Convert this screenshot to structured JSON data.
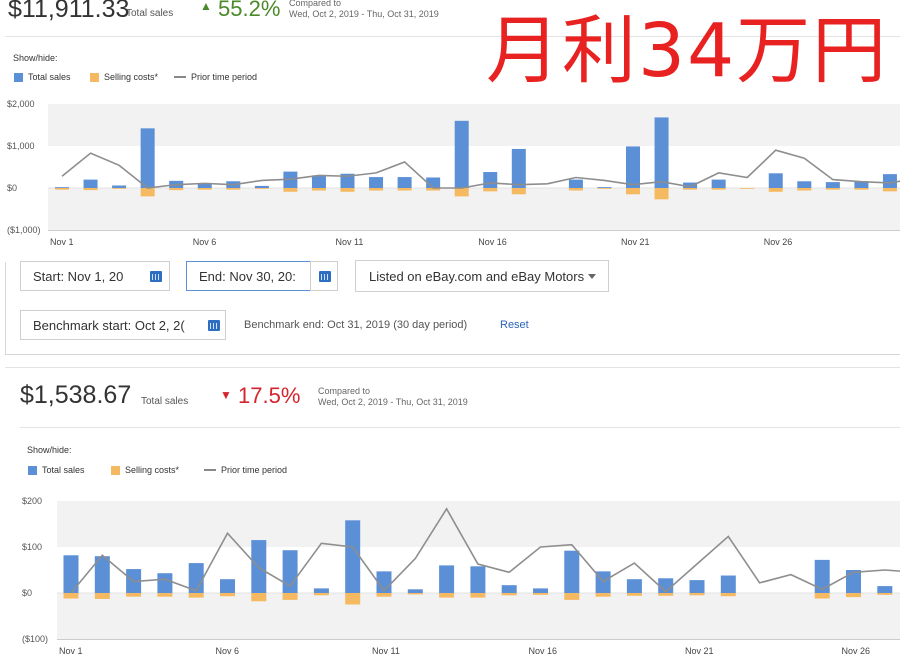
{
  "overlay": {
    "text": "月利34万円"
  },
  "colors": {
    "total_sales": "#5b8fd6",
    "selling_costs": "#f5b961",
    "prior": "#8e8e8e",
    "up": "#4a8a2a",
    "down": "#d4242d",
    "link": "#2a64b8",
    "overlay": "#e82121"
  },
  "panel1": {
    "total": "$11,911.33",
    "total_label": "Total sales",
    "change_arrow": "▲",
    "change": "55.2%",
    "compared_label": "Compared to",
    "compared_range": "Wed, Oct 2, 2019 - Thu, Oct 31, 2019",
    "showhide_label": "Show/hide:",
    "legend": {
      "total_sales": "Total sales",
      "selling_costs": "Selling costs*",
      "prior": "Prior time period"
    }
  },
  "controls": {
    "start_value": "Start: Nov 1, 20",
    "end_value": "End: Nov 30, 20:",
    "listing_select": "Listed on eBay.com and eBay Motors",
    "benchmark_start_value": "Benchmark start: Oct 2, 2(",
    "benchmark_end_text": "Benchmark end: Oct 31, 2019 (30 day period)",
    "reset_label": "Reset"
  },
  "panel2": {
    "total": "$1,538.67",
    "total_label": "Total sales",
    "change_arrow": "▼",
    "change": "17.5%",
    "compared_label": "Compared to",
    "compared_range": "Wed, Oct 2, 2019 - Thu, Oct 31, 2019",
    "showhide_label": "Show/hide:",
    "legend": {
      "total_sales": "Total sales",
      "selling_costs": "Selling costs*",
      "prior": "Prior time period"
    }
  },
  "chart_data": [
    {
      "type": "bar",
      "ylim": [
        -1000,
        2000
      ],
      "y_ticks": [
        -1000,
        0,
        1000,
        2000
      ],
      "y_tick_labels": [
        "($1,000)",
        "$0",
        "$1,000",
        "$2,000"
      ],
      "categories": [
        "Nov 1",
        "Nov 2",
        "Nov 3",
        "Nov 4",
        "Nov 5",
        "Nov 6",
        "Nov 7",
        "Nov 8",
        "Nov 9",
        "Nov 10",
        "Nov 11",
        "Nov 12",
        "Nov 13",
        "Nov 14",
        "Nov 15",
        "Nov 16",
        "Nov 17",
        "Nov 18",
        "Nov 19",
        "Nov 20",
        "Nov 21",
        "Nov 22",
        "Nov 23",
        "Nov 24",
        "Nov 25",
        "Nov 26",
        "Nov 27",
        "Nov 28",
        "Nov 29",
        "Nov 30"
      ],
      "x_tick_labels": [
        "Nov 1",
        "Nov 6",
        "Nov 11",
        "Nov 16",
        "Nov 21",
        "Nov 26"
      ],
      "x_tick_indices": [
        0,
        5,
        10,
        15,
        20,
        25
      ],
      "series": [
        {
          "name": "Total sales",
          "values": [
            20,
            200,
            60,
            1420,
            170,
            110,
            160,
            50,
            390,
            300,
            340,
            260,
            260,
            250,
            1600,
            380,
            930,
            0,
            200,
            20,
            990,
            1680,
            130,
            200,
            0,
            350,
            160,
            140,
            160,
            330,
            210
          ]
        },
        {
          "name": "Selling costs*",
          "values": [
            -40,
            -50,
            -20,
            -200,
            -50,
            -40,
            -40,
            -20,
            -90,
            -60,
            -90,
            -60,
            -60,
            -60,
            -200,
            -80,
            -150,
            0,
            -60,
            -20,
            -150,
            -270,
            -40,
            -40,
            -20,
            -90,
            -60,
            -40,
            -40,
            -80,
            -60
          ]
        },
        {
          "name": "Prior time period",
          "values": [
            280,
            830,
            540,
            0,
            80,
            110,
            80,
            180,
            210,
            300,
            280,
            360,
            620,
            0,
            0,
            120,
            80,
            100,
            250,
            180,
            80,
            150,
            30,
            360,
            250,
            900,
            710,
            200,
            150,
            120,
            240,
            250
          ]
        }
      ]
    },
    {
      "type": "bar",
      "ylim": [
        -100,
        200
      ],
      "y_ticks": [
        -100,
        0,
        100,
        200
      ],
      "y_tick_labels": [
        "($100)",
        "$0",
        "$100",
        "$200"
      ],
      "categories": [
        "Nov 1",
        "Nov 2",
        "Nov 3",
        "Nov 4",
        "Nov 5",
        "Nov 6",
        "Nov 7",
        "Nov 8",
        "Nov 9",
        "Nov 10",
        "Nov 11",
        "Nov 12",
        "Nov 13",
        "Nov 14",
        "Nov 15",
        "Nov 16",
        "Nov 17",
        "Nov 18",
        "Nov 19",
        "Nov 20",
        "Nov 21",
        "Nov 22",
        "Nov 23",
        "Nov 24",
        "Nov 25",
        "Nov 26",
        "Nov 27",
        "Nov 28"
      ],
      "x_tick_labels": [
        "Nov 1",
        "Nov 6",
        "Nov 11",
        "Nov 16",
        "Nov 21",
        "Nov 26"
      ],
      "x_tick_indices": [
        0,
        5,
        10,
        15,
        20,
        25
      ],
      "series": [
        {
          "name": "Total sales",
          "values": [
            82,
            80,
            52,
            43,
            65,
            30,
            115,
            93,
            10,
            158,
            47,
            8,
            60,
            58,
            17,
            10,
            92,
            47,
            30,
            32,
            28,
            38,
            0,
            0,
            72,
            50,
            15
          ]
        },
        {
          "name": "Selling costs*",
          "values": [
            -12,
            -13,
            -8,
            -8,
            -10,
            -7,
            -18,
            -15,
            -5,
            -25,
            -8,
            -3,
            -10,
            -10,
            -5,
            -4,
            -15,
            -8,
            -6,
            -6,
            -5,
            -7,
            0,
            0,
            -12,
            -9,
            -4
          ]
        },
        {
          "name": "Prior time period",
          "values": [
            0,
            82,
            25,
            30,
            5,
            130,
            55,
            15,
            108,
            100,
            5,
            75,
            183,
            63,
            45,
            100,
            105,
            25,
            65,
            3,
            63,
            123,
            22,
            40,
            8,
            45,
            50,
            45
          ]
        }
      ]
    }
  ]
}
